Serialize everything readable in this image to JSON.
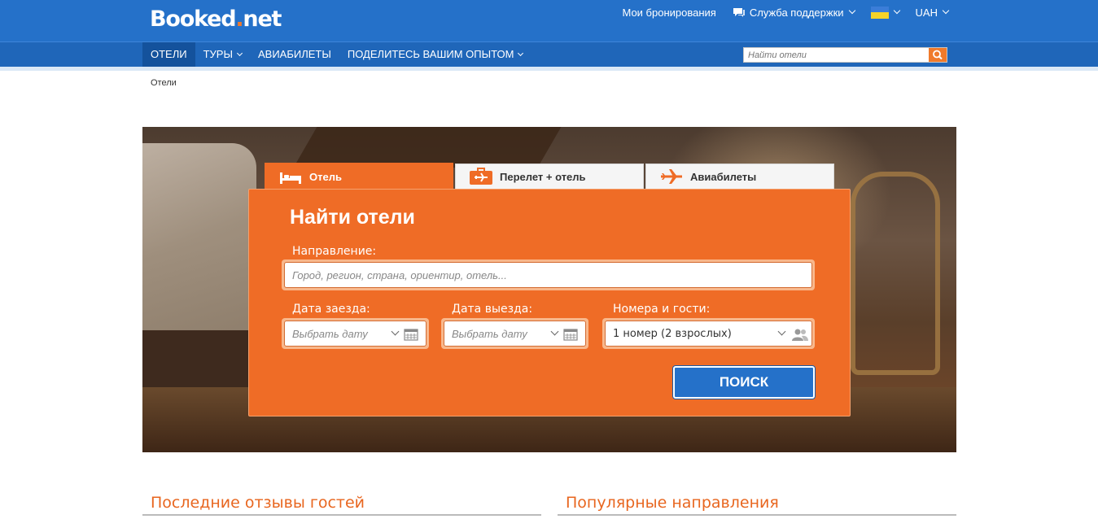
{
  "header": {
    "logo_main": "Booked",
    "logo_dot": ".",
    "logo_tld": "net",
    "my_bookings": "Мои бронирования",
    "support": "Служба поддержки",
    "currency": "UAH",
    "flag_colors": [
      "#3b7dd8",
      "#f5d328"
    ]
  },
  "nav": {
    "items": [
      {
        "label": "ОТЕЛИ",
        "active": true
      },
      {
        "label": "ТУРЫ",
        "dropdown": true
      },
      {
        "label": "АВИАБИЛЕТЫ"
      },
      {
        "label": "ПОДЕЛИТЕСЬ ВАШИМ ОПЫТОМ",
        "dropdown": true
      }
    ],
    "search_placeholder": "Найти отели"
  },
  "breadcrumb": "Отели",
  "tabs": [
    {
      "label": "Отель",
      "icon": "bed-icon",
      "active": true
    },
    {
      "label": "Перелет + отель",
      "icon": "suitcase-plane-icon"
    },
    {
      "label": "Авиабилеты",
      "icon": "plane-icon"
    }
  ],
  "search_form": {
    "title": "Найти отели",
    "destination_label": "Направление:",
    "destination_placeholder": "Город, регион, страна, ориентир, отель...",
    "checkin_label": "Дата заезда:",
    "checkin_placeholder": "Выбрать дату",
    "checkout_label": "Дата выезда:",
    "checkout_placeholder": "Выбрать дату",
    "rooms_label": "Номера и гости:",
    "rooms_value": "1 номер (2 взрослых)",
    "submit_label": "ПОИСК"
  },
  "sections": {
    "reviews_title": "Последние отзывы гостей",
    "popular_title": "Популярные направления"
  },
  "colors": {
    "brand_blue": "#2571c9",
    "accent_orange": "#ef6c26"
  }
}
